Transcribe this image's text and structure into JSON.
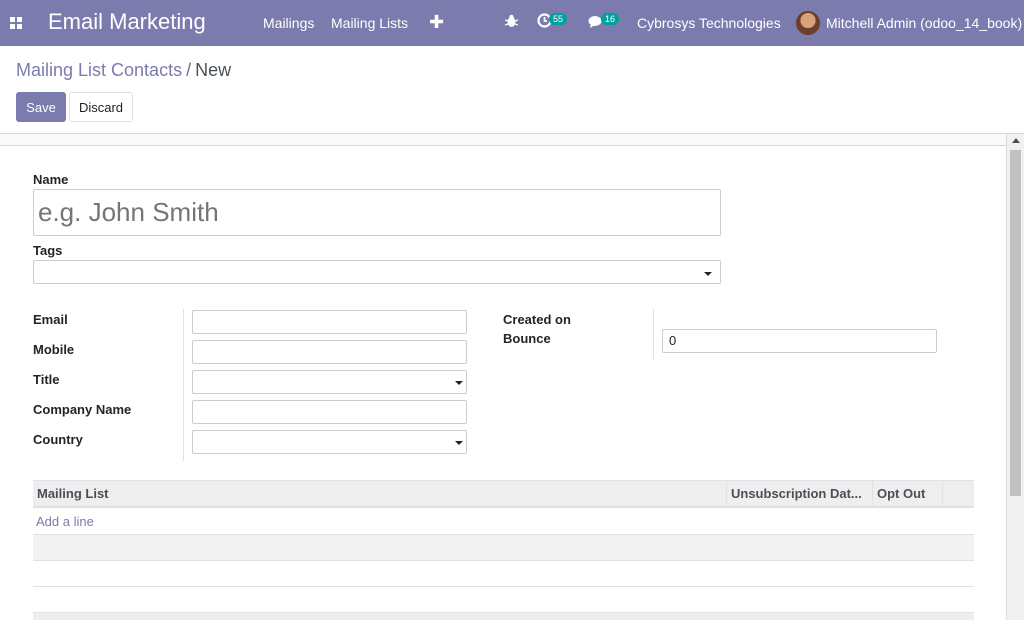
{
  "navbar": {
    "brand": "Email Marketing",
    "menu": [
      "Mailings",
      "Mailing Lists"
    ],
    "activity_count": "55",
    "message_count": "16",
    "company": "Cybrosys Technologies",
    "user": "Mitchell Admin (odoo_14_book)",
    "icons": [
      "apps-grid-icon",
      "plus-icon",
      "bug-icon",
      "clock-icon",
      "chat-icon",
      "avatar"
    ]
  },
  "breadcrumb": {
    "parent": "Mailing List Contacts",
    "separator": "/",
    "current": "New"
  },
  "actions": {
    "save": "Save",
    "discard": "Discard"
  },
  "form": {
    "name_label": "Name",
    "name_placeholder": "e.g. John Smith",
    "tags_label": "Tags",
    "email_label": "Email",
    "mobile_label": "Mobile",
    "title_label": "Title",
    "company_label": "Company Name",
    "country_label": "Country",
    "created_on_label": "Created on",
    "bounce_label": "Bounce",
    "bounce_value": "0"
  },
  "table": {
    "columns": [
      "Mailing List",
      "Unsubscription Dat...",
      "Opt Out"
    ],
    "add_line": "Add a line"
  },
  "colors": {
    "primary": "#7c7bad",
    "badge": "#00a09d"
  }
}
